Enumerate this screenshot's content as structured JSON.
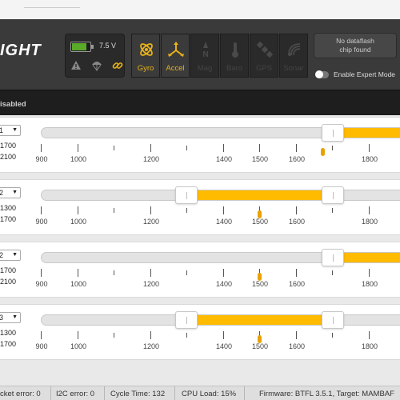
{
  "header": {
    "logo_text": "IGHT",
    "voltage": "7.5 V",
    "sensors": [
      {
        "label": "Gyro",
        "active": true
      },
      {
        "label": "Accel",
        "active": true
      },
      {
        "label": "Mag",
        "active": false
      },
      {
        "label": "Baro",
        "active": false
      },
      {
        "label": "GPS",
        "active": false
      },
      {
        "label": "Sonar",
        "active": false
      }
    ],
    "dataflash_line1": "No dataflash",
    "dataflash_line2": "chip found",
    "expert_mode_label": "Enable Expert Mode",
    "expert_mode_on": false
  },
  "status_bar": {
    "text": "isabled"
  },
  "ranges": [
    {
      "select": "1",
      "min": "1700",
      "max": "2100",
      "range_start": 1700,
      "range_end": 2100,
      "marker": 1700
    },
    {
      "select": "2",
      "min": "1300",
      "max": "1700",
      "range_start": 1300,
      "range_end": 1700,
      "marker": 1500
    },
    {
      "select": "2",
      "min": "1700",
      "max": "2100",
      "range_start": 1700,
      "range_end": 2100,
      "marker": 1500
    },
    {
      "select": "3",
      "min": "1300",
      "max": "1700",
      "range_start": 1300,
      "range_end": 1700,
      "marker": 1500
    }
  ],
  "scale_labels": [
    "900",
    "1000",
    "1200",
    "1400",
    "1500",
    "1600",
    "1800"
  ],
  "footer": {
    "packet_error": "cket error: 0",
    "i2c_error": "I2C error: 0",
    "cycle_time": "Cycle Time: 132",
    "cpu_load": "CPU Load: 15%",
    "firmware": "Firmware: BTFL 3.5.1, Target: MAMBAF"
  },
  "colors": {
    "accent": "#ffbb00",
    "header_bg": "#3a3a3a",
    "battery_green": "#59aa29"
  }
}
